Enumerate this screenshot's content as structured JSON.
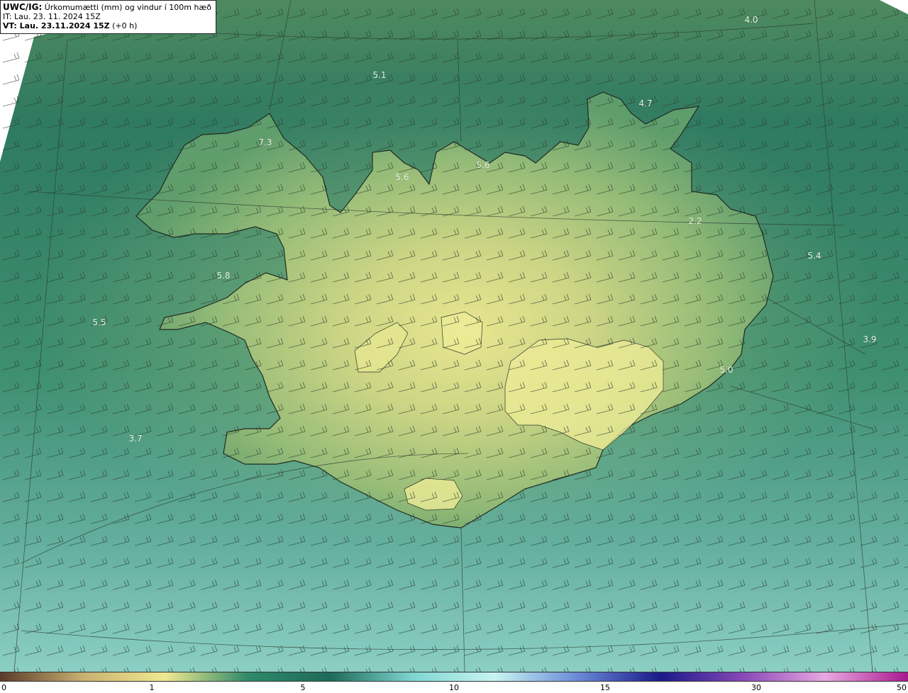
{
  "info": {
    "model": "UWC/IG:",
    "title": "Úrkomumætti (mm) og vindur í 100m hæð",
    "it": "IT: Lau. 23. 11. 2024 15Z",
    "vt_label": "VT: Lau. 23.11.2024 15Z",
    "vt_offset": "(+0 h)"
  },
  "map_labels": [
    "4.0",
    "5.1",
    "4.7",
    "5.6",
    "5.6",
    "7.3",
    "5.8",
    "5.5",
    "5.4",
    "3.9",
    "5.0",
    "3.7",
    "2.2"
  ],
  "colorbar": {
    "ticks": [
      "0",
      "1",
      "5",
      "10",
      "15",
      "30",
      "50"
    ],
    "colors": [
      "#5a3a2a",
      "#c8b070",
      "#f0e890",
      "#2e8a6a",
      "#1e6a5a",
      "#7ed6d0",
      "#c8f4f2",
      "#6a8ad8",
      "#1a1a88",
      "#8848b8",
      "#e8a8e0",
      "#a81890"
    ]
  },
  "colors": {
    "sea_north": "#2f7a62",
    "sea_south": "#6cb8ab",
    "land_low": "#5c9d6b",
    "land_high": "#e6e48a",
    "coast": "#1f2a1f",
    "barb": "#2a3a2a"
  }
}
